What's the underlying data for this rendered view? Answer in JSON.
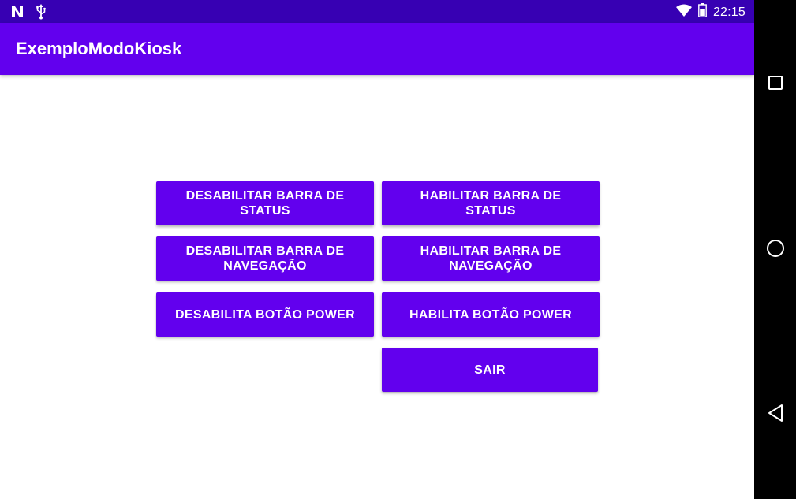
{
  "status_bar": {
    "time": "22:15",
    "left_icons": [
      "notification-n-icon",
      "usb-icon"
    ],
    "right_icons": [
      "wifi-icon",
      "battery-icon"
    ],
    "background": "#3700b3"
  },
  "app_bar": {
    "title": "ExemploModoKiosk",
    "background": "#6200ee"
  },
  "buttons": {
    "disable_status_bar": "DESABILITAR BARRA DE STATUS",
    "enable_status_bar": "HABILITAR BARRA DE STATUS",
    "disable_nav_bar": "DESABILITAR BARRA DE\nNAVEGAÇÃO",
    "enable_nav_bar": "HABILITAR BARRA DE\nNAVEGAÇÃO",
    "disable_power": "DESABILITA BOTÃO POWER",
    "enable_power": "HABILITA BOTÃO POWER",
    "exit": "SAIR",
    "color": "#6200ee"
  },
  "nav_bar": {
    "icons": [
      "recents-square-icon",
      "home-circle-icon",
      "back-triangle-icon"
    ]
  }
}
